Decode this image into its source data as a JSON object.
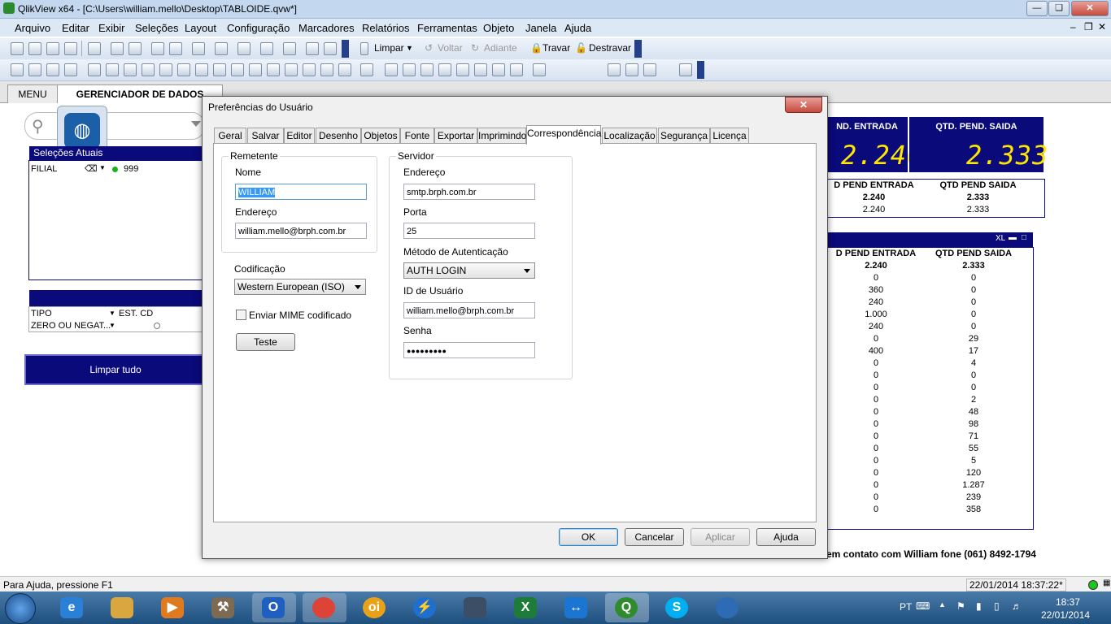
{
  "window": {
    "title": "QlikView x64 - [C:\\Users\\william.mello\\Desktop\\TABLOIDE.qvw*]"
  },
  "menubar": [
    "Arquivo",
    "Editar",
    "Exibir",
    "Seleções",
    "Layout",
    "Configuração",
    "Marcadores",
    "Relatórios",
    "Ferramentas",
    "Objeto",
    "Janela",
    "Ajuda"
  ],
  "toolbar": {
    "limpar": "Limpar",
    "voltar": "Voltar",
    "adiante": "Adiante",
    "travar": "Travar",
    "destravar": "Destravar"
  },
  "sheets": {
    "menu": "MENU",
    "gerenciador": "GERENCIADOR DE DADOS"
  },
  "left": {
    "listbox_title": "Seleções Atuais",
    "row1": {
      "field": "FILIAL",
      "value": "999"
    },
    "row_tipo": {
      "field": "TIPO",
      "value": "EST. CD"
    },
    "row_zero": {
      "field": "ZERO OU NEGAT..."
    },
    "clear_all": "Limpar tudo"
  },
  "right": {
    "kpi1_label": "ND. ENTRADA",
    "kpi1_value": "2.240",
    "kpi2_label": "QTD. PEND. SAIDA",
    "kpi2_value": "2.333",
    "mini_h1": "D PEND ENTRADA",
    "mini_h2": "QTD PEND SAIDA",
    "mini_t1": "2.240",
    "mini_t2": "2.333",
    "mini_r1": "2.240",
    "mini_r2": "2.333",
    "det_caption": "XL",
    "det_h1": "D PEND ENTRADA",
    "det_h2": "QTD PEND SAIDA",
    "det_t1": "2.240",
    "det_t2": "2.333",
    "det_rows": [
      [
        "0",
        "0"
      ],
      [
        "360",
        "0"
      ],
      [
        "240",
        "0"
      ],
      [
        "1.000",
        "0"
      ],
      [
        "240",
        "0"
      ],
      [
        "0",
        "29"
      ],
      [
        "400",
        "17"
      ],
      [
        "0",
        "4"
      ],
      [
        "0",
        "0"
      ],
      [
        "0",
        "0"
      ],
      [
        "0",
        "2"
      ],
      [
        "0",
        "48"
      ],
      [
        "0",
        "98"
      ],
      [
        "0",
        "71"
      ],
      [
        "0",
        "55"
      ],
      [
        "0",
        "5"
      ],
      [
        "0",
        "120"
      ],
      [
        "0",
        "1.287"
      ],
      [
        "0",
        "239"
      ],
      [
        "0",
        "358"
      ]
    ],
    "contact": "em contato com William fone (061) 8492-1794"
  },
  "status": {
    "help": "Para Ajuda, pressione F1",
    "timestamp": "22/01/2014 18:37:22*"
  },
  "tray": {
    "lang": "PT",
    "time": "18:37",
    "date": "22/01/2014"
  },
  "dialog": {
    "title": "Preferências do Usuário",
    "tabs": [
      "Geral",
      "Salvar",
      "Editor",
      "Desenho",
      "Objetos",
      "Fonte",
      "Exportar",
      "Imprimindo",
      "Correspondência",
      "Localização",
      "Segurança",
      "Licença"
    ],
    "remetente": {
      "group": "Remetente",
      "nome_label": "Nome",
      "nome_value": "WILLIAM",
      "endereco_label": "Endereço",
      "endereco_value": "william.mello@brph.com.br"
    },
    "codificacao_label": "Codificação",
    "codificacao_value": "Western European (ISO)",
    "mime_label": "Enviar MIME codificado",
    "teste": "Teste",
    "servidor": {
      "group": "Servidor",
      "endereco_label": "Endereço",
      "endereco_value": "smtp.brph.com.br",
      "porta_label": "Porta",
      "porta_value": "25",
      "auth_label": "Método de Autenticação",
      "auth_value": "AUTH LOGIN",
      "id_label": "ID de Usuário",
      "id_value": "william.mello@brph.com.br",
      "senha_label": "Senha",
      "senha_value": "●●●●●●●●●"
    },
    "buttons": {
      "ok": "OK",
      "cancel": "Cancelar",
      "apply": "Aplicar",
      "help": "Ajuda"
    }
  }
}
